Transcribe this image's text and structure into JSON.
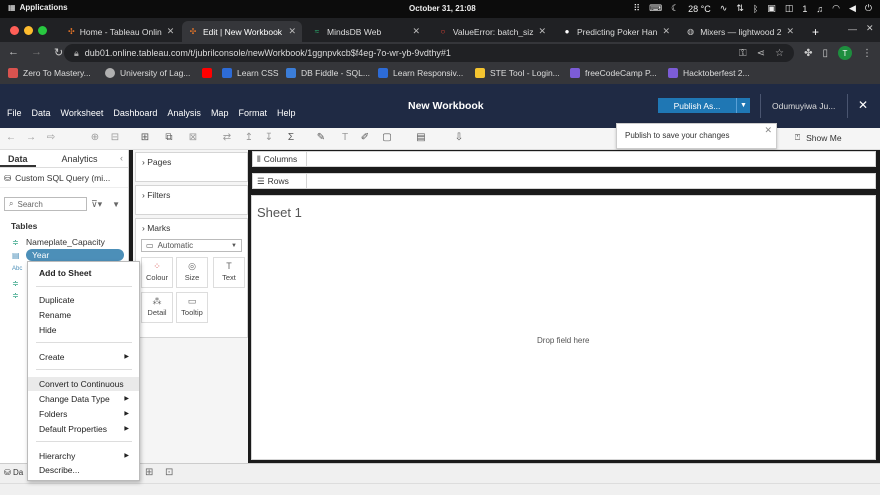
{
  "os": {
    "apps_label": "Applications",
    "clock": "October 31, 21:08",
    "temperature": "28 °C",
    "notif_count": "1"
  },
  "browser": {
    "tabs": [
      {
        "title": "Home - Tableau Onlin",
        "active": false
      },
      {
        "title": "Edit | New Workbook",
        "active": true
      },
      {
        "title": "MindsDB Web",
        "active": false
      },
      {
        "title": "ValueError: batch_siz",
        "active": false
      },
      {
        "title": "Predicting Poker Han",
        "active": false
      },
      {
        "title": "Mixers — lightwood 2",
        "active": false
      }
    ],
    "url": "dub01.online.tableau.com/t/jubrilconsole/newWorkbook/1ggnpvkcb$f4eg-7o-wr-yb-9vdthy#1",
    "avatar_letter": "T",
    "bookmarks": [
      "Zero To Mastery...",
      "University of Lag...",
      "Learn CSS",
      "DB Fiddle - SQL...",
      "Learn Responsiv...",
      "STE Tool - Login...",
      "freeCodeCamp P...",
      "Hacktoberfest 2..."
    ]
  },
  "tableau": {
    "menu": [
      "File",
      "Data",
      "Worksheet",
      "Dashboard",
      "Analysis",
      "Map",
      "Format",
      "Help"
    ],
    "workbook_title": "New Workbook",
    "publish_label": "Publish As...",
    "user_name": "Odumuyiwa Ju...",
    "show_me": "Show Me",
    "popover_text": "Publish to save your changes",
    "data_pane": {
      "tab_data": "Data",
      "tab_analytics": "Analytics",
      "source": "Custom SQL Query (mi...",
      "search_placeholder": "Search",
      "tables_label": "Tables",
      "fields": [
        "Nameplate_Capacity",
        "Year"
      ]
    },
    "cards": {
      "pages": "Pages",
      "filters": "Filters",
      "marks": "Marks",
      "mark_type": "Automatic",
      "mark_buttons": [
        "Colour",
        "Size",
        "Text",
        "Detail",
        "Tooltip"
      ]
    },
    "shelves": {
      "columns": "Columns",
      "rows": "Rows"
    },
    "sheet": {
      "title": "Sheet 1",
      "drop_hint": "Drop field here"
    },
    "bottom_tab": "Da"
  },
  "context_menu": {
    "items": [
      "Add to Sheet",
      "Duplicate",
      "Rename",
      "Hide",
      "Create",
      "Convert to Continuous",
      "Change Data Type",
      "Folders",
      "Default Properties",
      "Hierarchy",
      "Describe..."
    ]
  }
}
